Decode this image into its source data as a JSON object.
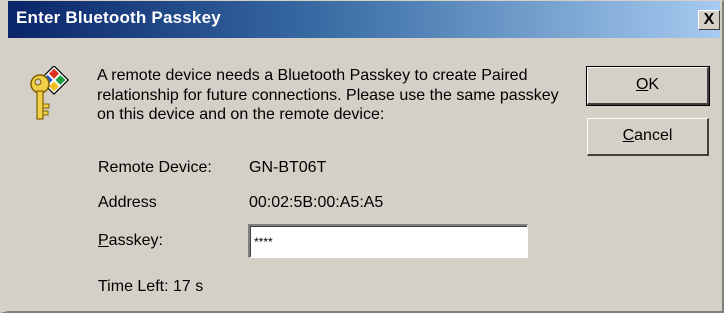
{
  "dialog": {
    "title": "Enter Bluetooth Passkey",
    "close_label": "X",
    "message": "A remote device needs a Bluetooth Passkey to create Paired relationship for future connections. Please use the same passkey on this device and on the remote device:",
    "ok_label": "OK",
    "ok_accel": "O",
    "ok_rest": "K",
    "cancel_label": "Cancel",
    "cancel_accel": "C",
    "cancel_rest": "ancel",
    "fields": {
      "remote_device_label": "Remote Device:",
      "remote_device_value": "GN-BT06T",
      "address_label": "Address",
      "address_value": "00:02:5B:00:A5:A5",
      "passkey_label": "Passkey:",
      "passkey_accel": "P",
      "passkey_rest": "asskey:",
      "passkey_value": "****"
    },
    "time_left": "Time Left: 17 s"
  },
  "icons": {
    "key": "key-icon"
  },
  "colors": {
    "title_bar_start": "#0a246a",
    "title_bar_end": "#a6caf0",
    "dialog_face": "#d4d0c8"
  }
}
